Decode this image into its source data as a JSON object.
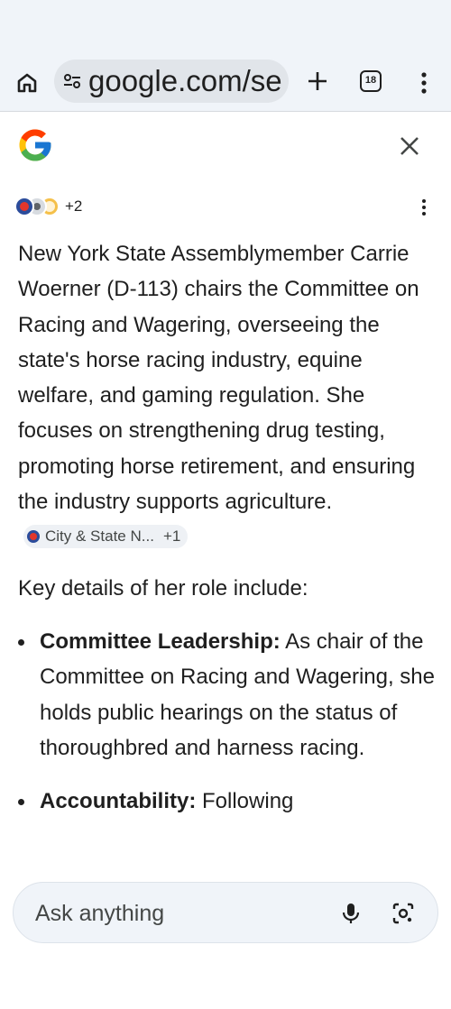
{
  "browser": {
    "url": "google.com/se",
    "tab_count": "18",
    "icons": [
      "home-icon",
      "tune-icon",
      "plus-icon",
      "tab-switcher-icon",
      "more-vert-icon"
    ]
  },
  "header": {
    "logo": "google-g-logo",
    "close": "close-icon"
  },
  "sources": {
    "count_label": "+2"
  },
  "answer": {
    "paragraph": "New York State Assemblymember Carrie Woerner (D-113) chairs the Committee on Racing and Wagering, overseeing the state's horse racing industry, equine welfare, and gaming regulation. She focuses on strengthening drug testing, promoting horse retirement, and ensuring the industry supports agriculture.",
    "citation": {
      "label": "City & State N...",
      "more": "+1"
    },
    "subhead": "Key details of her role include:",
    "bullets": [
      {
        "title": "Committee Leadership:",
        "text": " As chair of the Committee on Racing and Wagering, she holds public hearings on the status of thoroughbred and harness racing."
      },
      {
        "title": "Accountability:",
        "text": " Following"
      }
    ]
  },
  "ask_bar": {
    "placeholder": "Ask anything",
    "icons": [
      "mic-icon",
      "lens-icon"
    ]
  },
  "colors": {
    "toolbar_bg": "#f0f4f9",
    "omnibox_bg": "#e1e5ea",
    "text": "#1f1f1f",
    "chip_bg": "#eef1f5"
  }
}
